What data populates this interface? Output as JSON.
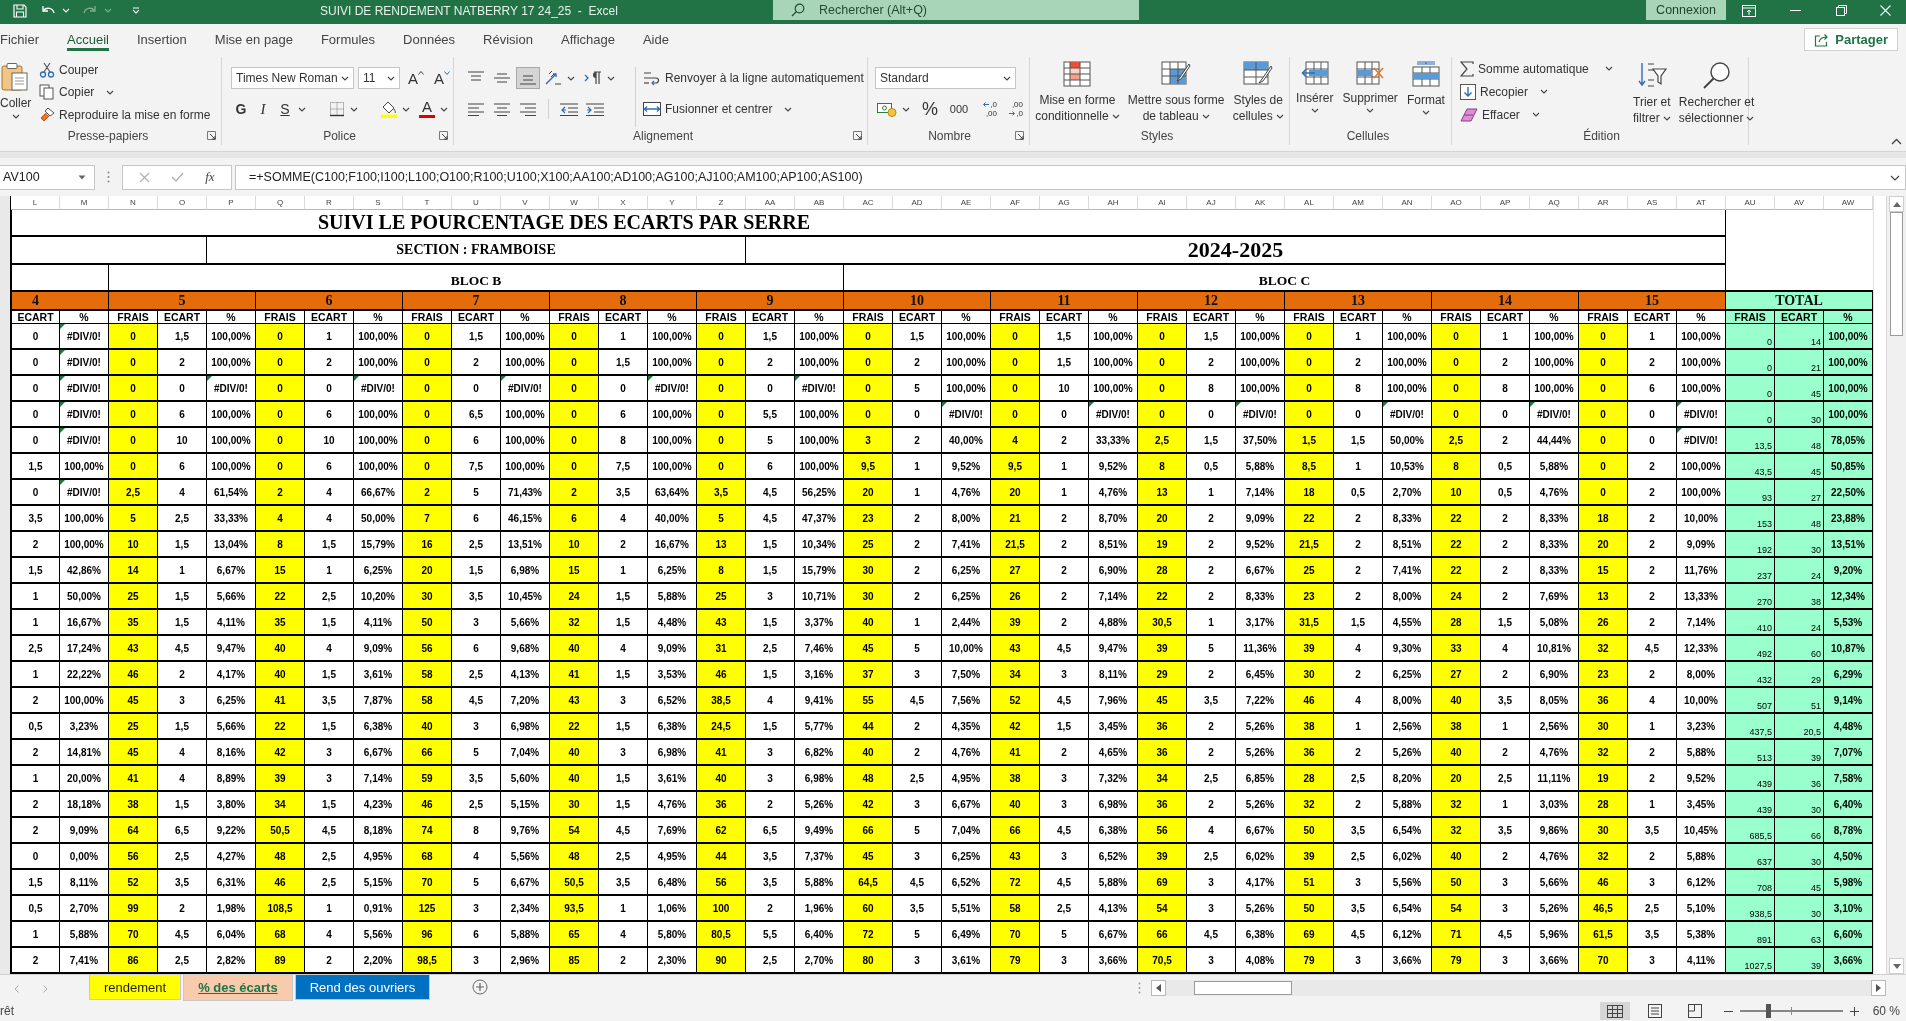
{
  "title_bar": {
    "title": "SUIVI DE RENDEMENT NATBERRY 17 24_25  -  Excel",
    "search_placeholder": "Rechercher (Alt+Q)",
    "account_button": "Connexion"
  },
  "menu_tabs": [
    {
      "label": "Fichier",
      "selected": false
    },
    {
      "label": "Accueil",
      "selected": true
    },
    {
      "label": "Insertion",
      "selected": false
    },
    {
      "label": "Mise en page",
      "selected": false
    },
    {
      "label": "Formules",
      "selected": false
    },
    {
      "label": "Données",
      "selected": false
    },
    {
      "label": "Révision",
      "selected": false
    },
    {
      "label": "Affichage",
      "selected": false
    },
    {
      "label": "Aide",
      "selected": false
    }
  ],
  "share_button": "Partager",
  "ribbon": {
    "clipboard": {
      "label": "Presse-papiers",
      "paste": "Coller",
      "cut": "Couper",
      "copy": "Copier",
      "format_painter": "Reproduire la mise en forme"
    },
    "font": {
      "label": "Police",
      "family": "Times New Roman",
      "size": "11",
      "grow": "A",
      "shrink": "A",
      "bold": "G",
      "italic": "I",
      "underline": "S",
      "font_color": "A"
    },
    "alignment": {
      "label": "Alignement",
      "vertical": [
        {
          "kind": "top",
          "selected": false
        },
        {
          "kind": "middle",
          "selected": false
        },
        {
          "kind": "bottom",
          "selected": true
        }
      ],
      "wrap_text": "Renvoyer à la ligne automatiquement",
      "merge": "Fusionner et centrer"
    },
    "number": {
      "label": "Nombre",
      "format": "Standard",
      "percent": "%",
      "thousands": "000",
      "decimals": [
        {
          "kind": "increase",
          "top": ",0",
          "bottom": ",00"
        },
        {
          "kind": "decrease",
          "top": ",00",
          "bottom": ",0"
        }
      ]
    },
    "styles": {
      "label": "Styles",
      "buttons": [
        {
          "kind": "conditional",
          "label": "Mise en forme\nconditionnelle"
        },
        {
          "kind": "table",
          "label": "Mettre sous forme\nde tableau"
        },
        {
          "kind": "cellstyles",
          "label": "Styles de\ncellules"
        }
      ]
    },
    "cells": {
      "label": "Cellules",
      "buttons": [
        {
          "kind": "insert",
          "label": "Insérer"
        },
        {
          "kind": "delete",
          "label": "Supprimer"
        },
        {
          "kind": "format",
          "label": "Format"
        }
      ]
    },
    "editing": {
      "label": "Édition",
      "autosum": "Somme automatique",
      "fill": "Recopier",
      "clear": "Effacer",
      "sort_filter": "Trier et\nfiltrer",
      "find_select": "Rechercher et\nsélectionner"
    }
  },
  "formula_bar": {
    "name_box": "AV100",
    "function_glyph": "fx",
    "formula": "=+SOMME(C100;F100;I100;L100;O100;R100;U100;X100;AA100;AD100;AG100;AJ100;AM100;AP100;AS100)"
  },
  "sheet": {
    "title": "SUIVI LE POURCENTAGE DES ECARTS PAR SERRE",
    "section": "SECTION : FRAMBOISE",
    "season": "2024-2025",
    "sections": [
      {
        "kind": "lead",
        "blocks": [
          {
            "label": "4",
            "kind": "serre",
            "columns": [
              {
                "letter": "L",
                "label": "ECART",
                "kind": "ecart"
              },
              {
                "letter": "M",
                "label": "%",
                "kind": "percent"
              }
            ]
          }
        ]
      },
      {
        "kind": "bloc",
        "label": "BLOC B",
        "blocks": [
          {
            "label": "5",
            "kind": "serre",
            "columns": [
              {
                "letter": "N",
                "label": "FRAIS",
                "kind": "frais"
              },
              {
                "letter": "O",
                "label": "ECART",
                "kind": "ecart"
              },
              {
                "letter": "P",
                "label": "%",
                "kind": "percent"
              }
            ]
          },
          {
            "label": "6",
            "kind": "serre",
            "columns": [
              {
                "letter": "Q",
                "label": "FRAIS",
                "kind": "frais"
              },
              {
                "letter": "R",
                "label": "ECART",
                "kind": "ecart"
              },
              {
                "letter": "S",
                "label": "%",
                "kind": "percent"
              }
            ]
          },
          {
            "label": "7",
            "kind": "serre",
            "columns": [
              {
                "letter": "T",
                "label": "FRAIS",
                "kind": "frais"
              },
              {
                "letter": "U",
                "label": "ECART",
                "kind": "ecart"
              },
              {
                "letter": "V",
                "label": "%",
                "kind": "percent"
              }
            ]
          },
          {
            "label": "8",
            "kind": "serre",
            "columns": [
              {
                "letter": "W",
                "label": "FRAIS",
                "kind": "frais"
              },
              {
                "letter": "X",
                "label": "ECART",
                "kind": "ecart"
              },
              {
                "letter": "Y",
                "label": "%",
                "kind": "percent"
              }
            ]
          },
          {
            "label": "9",
            "kind": "serre",
            "columns": [
              {
                "letter": "Z",
                "label": "FRAIS",
                "kind": "frais"
              },
              {
                "letter": "AA",
                "label": "ECART",
                "kind": "ecart"
              },
              {
                "letter": "AB",
                "label": "%",
                "kind": "percent"
              }
            ]
          }
        ]
      },
      {
        "kind": "bloc",
        "label": "BLOC C",
        "blocks": [
          {
            "label": "10",
            "kind": "serre",
            "columns": [
              {
                "letter": "AC",
                "label": "FRAIS",
                "kind": "frais"
              },
              {
                "letter": "AD",
                "label": "ECART",
                "kind": "ecart"
              },
              {
                "letter": "AE",
                "label": "%",
                "kind": "percent"
              }
            ]
          },
          {
            "label": "11",
            "kind": "serre",
            "columns": [
              {
                "letter": "AF",
                "label": "FRAIS",
                "kind": "frais"
              },
              {
                "letter": "AG",
                "label": "ECART",
                "kind": "ecart"
              },
              {
                "letter": "AH",
                "label": "%",
                "kind": "percent"
              }
            ]
          },
          {
            "label": "12",
            "kind": "serre",
            "columns": [
              {
                "letter": "AI",
                "label": "FRAIS",
                "kind": "frais"
              },
              {
                "letter": "AJ",
                "label": "ECART",
                "kind": "ecart"
              },
              {
                "letter": "AK",
                "label": "%",
                "kind": "percent"
              }
            ]
          },
          {
            "label": "13",
            "kind": "serre",
            "columns": [
              {
                "letter": "AL",
                "label": "FRAIS",
                "kind": "frais"
              },
              {
                "letter": "AM",
                "label": "ECART",
                "kind": "ecart"
              },
              {
                "letter": "AN",
                "label": "%",
                "kind": "percent"
              }
            ]
          },
          {
            "label": "14",
            "kind": "serre",
            "columns": [
              {
                "letter": "AO",
                "label": "FRAIS",
                "kind": "frais"
              },
              {
                "letter": "AP",
                "label": "ECART",
                "kind": "ecart"
              },
              {
                "letter": "AQ",
                "label": "%",
                "kind": "percent"
              }
            ]
          },
          {
            "label": "15",
            "kind": "serre",
            "columns": [
              {
                "letter": "AR",
                "label": "FRAIS",
                "kind": "frais"
              },
              {
                "letter": "AS",
                "label": "ECART",
                "kind": "ecart"
              },
              {
                "letter": "AT",
                "label": "%",
                "kind": "percent"
              }
            ]
          }
        ]
      },
      {
        "kind": "total",
        "blocks": [
          {
            "label": "TOTAL",
            "kind": "total",
            "columns": [
              {
                "letter": "AU",
                "label": "FRAIS",
                "kind": "totalvalue"
              },
              {
                "letter": "AV",
                "label": "ECART",
                "kind": "totalvalue"
              },
              {
                "letter": "AW",
                "label": "%",
                "kind": "totalpercent"
              }
            ]
          }
        ]
      }
    ],
    "rows": [
      [
        "0",
        {
          "text": "#DIV/0!",
          "flagged": true
        },
        "0",
        "1,5",
        "100,00%",
        "0",
        "1",
        "100,00%",
        "0",
        "1,5",
        "100,00%",
        "0",
        "1",
        "100,00%",
        "0",
        "1,5",
        "100,00%",
        "0",
        "1,5",
        "100,00%",
        "0",
        "1,5",
        "100,00%",
        "0",
        "1,5",
        "100,00%",
        "0",
        "1",
        "100,00%",
        "0",
        "1",
        "100,00%",
        "0",
        "1",
        "100,00%",
        "0",
        "14",
        "100,00%"
      ],
      [
        "0",
        {
          "text": "#DIV/0!",
          "flagged": true
        },
        "0",
        "2",
        "100,00%",
        "0",
        "2",
        "100,00%",
        "0",
        "2",
        "100,00%",
        "0",
        "1,5",
        "100,00%",
        "0",
        "2",
        "100,00%",
        "0",
        "2",
        "100,00%",
        "0",
        "1,5",
        "100,00%",
        "0",
        "2",
        "100,00%",
        "0",
        "2",
        "100,00%",
        "0",
        "2",
        "100,00%",
        "0",
        "2",
        "100,00%",
        "0",
        "21",
        "100,00%"
      ],
      [
        "0",
        {
          "text": "#DIV/0!",
          "flagged": true
        },
        "0",
        "0",
        {
          "text": "#DIV/0!",
          "flagged": true
        },
        "0",
        "0",
        {
          "text": "#DIV/0!",
          "flagged": true
        },
        "0",
        "0",
        {
          "text": "#DIV/0!",
          "flagged": true
        },
        "0",
        "0",
        {
          "text": "#DIV/0!",
          "flagged": true
        },
        "0",
        "0",
        {
          "text": "#DIV/0!",
          "flagged": true
        },
        "0",
        "5",
        "100,00%",
        "0",
        "10",
        "100,00%",
        "0",
        "8",
        "100,00%",
        "0",
        "8",
        "100,00%",
        "0",
        "8",
        "100,00%",
        "0",
        "6",
        "100,00%",
        "0",
        "45",
        "100,00%"
      ],
      [
        "0",
        {
          "text": "#DIV/0!",
          "flagged": true
        },
        "0",
        "6",
        "100,00%",
        "0",
        "6",
        "100,00%",
        "0",
        "6,5",
        "100,00%",
        "0",
        "6",
        "100,00%",
        "0",
        "5,5",
        "100,00%",
        "0",
        "0",
        {
          "text": "#DIV/0!",
          "flagged": true
        },
        "0",
        "0",
        {
          "text": "#DIV/0!",
          "flagged": true
        },
        "0",
        "0",
        {
          "text": "#DIV/0!",
          "flagged": true
        },
        "0",
        "0",
        {
          "text": "#DIV/0!",
          "flagged": true
        },
        "0",
        "0",
        {
          "text": "#DIV/0!",
          "flagged": true
        },
        "0",
        "0",
        {
          "text": "#DIV/0!",
          "flagged": true
        },
        "0",
        "30",
        "100,00%"
      ],
      [
        "0",
        {
          "text": "#DIV/0!",
          "flagged": true
        },
        "0",
        "10",
        "100,00%",
        "0",
        "10",
        "100,00%",
        "0",
        "6",
        "100,00%",
        "0",
        "8",
        "100,00%",
        "0",
        "5",
        "100,00%",
        "3",
        "2",
        "40,00%",
        "4",
        "2",
        "33,33%",
        "2,5",
        "1,5",
        "37,50%",
        "1,5",
        "1,5",
        "50,00%",
        "2,5",
        "2",
        "44,44%",
        "0",
        "0",
        {
          "text": "#DIV/0!",
          "flagged": true
        },
        "13,5",
        "48",
        "78,05%"
      ],
      [
        "1,5",
        "100,00%",
        "0",
        "6",
        "100,00%",
        "0",
        "6",
        "100,00%",
        "0",
        "7,5",
        "100,00%",
        "0",
        "7,5",
        "100,00%",
        "0",
        "6",
        "100,00%",
        "9,5",
        "1",
        "9,52%",
        "9,5",
        "1",
        "9,52%",
        "8",
        "0,5",
        "5,88%",
        "8,5",
        "1",
        "10,53%",
        "8",
        "0,5",
        "5,88%",
        "0",
        "2",
        "100,00%",
        "43,5",
        "45",
        "50,85%"
      ],
      [
        "0",
        {
          "text": "#DIV/0!",
          "flagged": true
        },
        "2,5",
        "4",
        "61,54%",
        "2",
        "4",
        "66,67%",
        "2",
        "5",
        "71,43%",
        "2",
        "3,5",
        "63,64%",
        "3,5",
        "4,5",
        "56,25%",
        "20",
        "1",
        "4,76%",
        "20",
        "1",
        "4,76%",
        "13",
        "1",
        "7,14%",
        "18",
        "0,5",
        "2,70%",
        "10",
        "0,5",
        "4,76%",
        "0",
        "2",
        "100,00%",
        "93",
        "27",
        "22,50%"
      ],
      [
        "3,5",
        "100,00%",
        "5",
        "2,5",
        "33,33%",
        "4",
        "4",
        "50,00%",
        "7",
        "6",
        "46,15%",
        "6",
        "4",
        "40,00%",
        "5",
        "4,5",
        "47,37%",
        "23",
        "2",
        "8,00%",
        "21",
        "2",
        "8,70%",
        "20",
        "2",
        "9,09%",
        "22",
        "2",
        "8,33%",
        "22",
        "2",
        "8,33%",
        "18",
        "2",
        "10,00%",
        "153",
        "48",
        "23,88%"
      ],
      [
        "2",
        "100,00%",
        "10",
        "1,5",
        "13,04%",
        "8",
        "1,5",
        "15,79%",
        "16",
        "2,5",
        "13,51%",
        "10",
        "2",
        "16,67%",
        "13",
        "1,5",
        "10,34%",
        "25",
        "2",
        "7,41%",
        "21,5",
        "2",
        "8,51%",
        "19",
        "2",
        "9,52%",
        "21,5",
        "2",
        "8,51%",
        "22",
        "2",
        "8,33%",
        "20",
        "2",
        "9,09%",
        "192",
        "30",
        "13,51%"
      ],
      [
        "1,5",
        "42,86%",
        "14",
        "1",
        "6,67%",
        "15",
        "1",
        "6,25%",
        "20",
        "1,5",
        "6,98%",
        "15",
        "1",
        "6,25%",
        "8",
        "1,5",
        "15,79%",
        "30",
        "2",
        "6,25%",
        "27",
        "2",
        "6,90%",
        "28",
        "2",
        "6,67%",
        "25",
        "2",
        "7,41%",
        "22",
        "2",
        "8,33%",
        "15",
        "2",
        "11,76%",
        "237",
        "24",
        "9,20%"
      ],
      [
        "1",
        "50,00%",
        "25",
        "1,5",
        "5,66%",
        "22",
        "2,5",
        "10,20%",
        "30",
        "3,5",
        "10,45%",
        "24",
        "1,5",
        "5,88%",
        "25",
        "3",
        "10,71%",
        "30",
        "2",
        "6,25%",
        "26",
        "2",
        "7,14%",
        "22",
        "2",
        "8,33%",
        "23",
        "2",
        "8,00%",
        "24",
        "2",
        "7,69%",
        "13",
        "2",
        "13,33%",
        "270",
        "38",
        "12,34%"
      ],
      [
        "1",
        "16,67%",
        "35",
        "1,5",
        "4,11%",
        "35",
        "1,5",
        "4,11%",
        "50",
        "3",
        "5,66%",
        "32",
        "1,5",
        "4,48%",
        "43",
        "1,5",
        "3,37%",
        "40",
        "1",
        "2,44%",
        "39",
        "2",
        "4,88%",
        "30,5",
        "1",
        "3,17%",
        "31,5",
        "1,5",
        "4,55%",
        "28",
        "1,5",
        "5,08%",
        "26",
        "2",
        "7,14%",
        "410",
        "24",
        "5,53%"
      ],
      [
        "2,5",
        "17,24%",
        "43",
        "4,5",
        "9,47%",
        "40",
        "4",
        "9,09%",
        "56",
        "6",
        "9,68%",
        "40",
        "4",
        "9,09%",
        "31",
        "2,5",
        "7,46%",
        "45",
        "5",
        "10,00%",
        "43",
        "4,5",
        "9,47%",
        "39",
        "5",
        "11,36%",
        "39",
        "4",
        "9,30%",
        "33",
        "4",
        "10,81%",
        "32",
        "4,5",
        "12,33%",
        "492",
        "60",
        "10,87%"
      ],
      [
        "1",
        "22,22%",
        "46",
        "2",
        "4,17%",
        "40",
        "1,5",
        "3,61%",
        "58",
        "2,5",
        "4,13%",
        "41",
        "1,5",
        "3,53%",
        "46",
        "1,5",
        "3,16%",
        "37",
        "3",
        "7,50%",
        "34",
        "3",
        "8,11%",
        "29",
        "2",
        "6,45%",
        "30",
        "2",
        "6,25%",
        "27",
        "2",
        "6,90%",
        "23",
        "2",
        "8,00%",
        "432",
        "29",
        "6,29%"
      ],
      [
        "2",
        "100,00%",
        "45",
        "3",
        "6,25%",
        "41",
        "3,5",
        "7,87%",
        "58",
        "4,5",
        "7,20%",
        "43",
        "3",
        "6,52%",
        "38,5",
        "4",
        "9,41%",
        "55",
        "4,5",
        "7,56%",
        "52",
        "4,5",
        "7,96%",
        "45",
        "3,5",
        "7,22%",
        "46",
        "4",
        "8,00%",
        "40",
        "3,5",
        "8,05%",
        "36",
        "4",
        "10,00%",
        "507",
        "51",
        "9,14%"
      ],
      [
        "0,5",
        "3,23%",
        "25",
        "1,5",
        "5,66%",
        "22",
        "1,5",
        "6,38%",
        "40",
        "3",
        "6,98%",
        "22",
        "1,5",
        "6,38%",
        "24,5",
        "1,5",
        "5,77%",
        "44",
        "2",
        "4,35%",
        "42",
        "1,5",
        "3,45%",
        "36",
        "2",
        "5,26%",
        "38",
        "1",
        "2,56%",
        "38",
        "1",
        "2,56%",
        "30",
        "1",
        "3,23%",
        "437,5",
        "20,5",
        "4,48%"
      ],
      [
        "2",
        "14,81%",
        "45",
        "4",
        "8,16%",
        "42",
        "3",
        "6,67%",
        "66",
        "5",
        "7,04%",
        "40",
        "3",
        "6,98%",
        "41",
        "3",
        "6,82%",
        "40",
        "2",
        "4,76%",
        "41",
        "2",
        "4,65%",
        "36",
        "2",
        "5,26%",
        "36",
        "2",
        "5,26%",
        "40",
        "2",
        "4,76%",
        "32",
        "2",
        "5,88%",
        "513",
        "39",
        "7,07%"
      ],
      [
        "1",
        "20,00%",
        "41",
        "4",
        "8,89%",
        "39",
        "3",
        "7,14%",
        "59",
        "3,5",
        "5,60%",
        "40",
        "1,5",
        "3,61%",
        "40",
        "3",
        "6,98%",
        "48",
        "2,5",
        "4,95%",
        "38",
        "3",
        "7,32%",
        "34",
        "2,5",
        "6,85%",
        "28",
        "2,5",
        "8,20%",
        "20",
        "2,5",
        "11,11%",
        "19",
        "2",
        "9,52%",
        "439",
        "36",
        "7,58%"
      ],
      [
        "2",
        "18,18%",
        "38",
        "1,5",
        "3,80%",
        "34",
        "1,5",
        "4,23%",
        "46",
        "2,5",
        "5,15%",
        "30",
        "1,5",
        "4,76%",
        "36",
        "2",
        "5,26%",
        "42",
        "3",
        "6,67%",
        "40",
        "3",
        "6,98%",
        "36",
        "2",
        "5,26%",
        "32",
        "2",
        "5,88%",
        "32",
        "1",
        "3,03%",
        "28",
        "1",
        "3,45%",
        "439",
        "30",
        "6,40%"
      ],
      [
        "2",
        "9,09%",
        "64",
        "6,5",
        "9,22%",
        "50,5",
        "4,5",
        "8,18%",
        "74",
        "8",
        "9,76%",
        "54",
        "4,5",
        "7,69%",
        "62",
        "6,5",
        "9,49%",
        "66",
        "5",
        "7,04%",
        "66",
        "4,5",
        "6,38%",
        "56",
        "4",
        "6,67%",
        "50",
        "3,5",
        "6,54%",
        "32",
        "3,5",
        "9,86%",
        "30",
        "3,5",
        "10,45%",
        "685,5",
        "66",
        "8,78%"
      ],
      [
        "0",
        "0,00%",
        "56",
        "2,5",
        "4,27%",
        "48",
        "2,5",
        "4,95%",
        "68",
        "4",
        "5,56%",
        "48",
        "2,5",
        "4,95%",
        "44",
        "3,5",
        "7,37%",
        "45",
        "3",
        "6,25%",
        "43",
        "3",
        "6,52%",
        "39",
        "2,5",
        "6,02%",
        "39",
        "2,5",
        "6,02%",
        "40",
        "2",
        "4,76%",
        "32",
        "2",
        "5,88%",
        "637",
        "30",
        "4,50%"
      ],
      [
        "1,5",
        "8,11%",
        "52",
        "3,5",
        "6,31%",
        "46",
        "2,5",
        "5,15%",
        "70",
        "5",
        "6,67%",
        "50,5",
        "3,5",
        "6,48%",
        "56",
        "3,5",
        "5,88%",
        "64,5",
        "4,5",
        "6,52%",
        "72",
        "4,5",
        "5,88%",
        "69",
        "3",
        "4,17%",
        "51",
        "3",
        "5,56%",
        "50",
        "3",
        "5,66%",
        "46",
        "3",
        "6,12%",
        "708",
        "45",
        "5,98%"
      ],
      [
        "0,5",
        "2,70%",
        "99",
        "2",
        "1,98%",
        "108,5",
        "1",
        "0,91%",
        "125",
        "3",
        "2,34%",
        "93,5",
        "1",
        "1,06%",
        "100",
        "2",
        "1,96%",
        "60",
        "3,5",
        "5,51%",
        "58",
        "2,5",
        "4,13%",
        "54",
        "3",
        "5,26%",
        "50",
        "3,5",
        "6,54%",
        "54",
        "3",
        "5,26%",
        "46,5",
        "2,5",
        "5,10%",
        "938,5",
        "30",
        "3,10%"
      ],
      [
        "1",
        "5,88%",
        "70",
        "4,5",
        "6,04%",
        "68",
        "4",
        "5,56%",
        "96",
        "6",
        "5,88%",
        "65",
        "4",
        "5,80%",
        "80,5",
        "5,5",
        "6,40%",
        "72",
        "5",
        "6,49%",
        "70",
        "5",
        "6,67%",
        "66",
        "4,5",
        "6,38%",
        "69",
        "4,5",
        "6,12%",
        "71",
        "4,5",
        "5,96%",
        "61,5",
        "3,5",
        "5,38%",
        "891",
        "63",
        "6,60%"
      ],
      [
        "2",
        "7,41%",
        "86",
        "2,5",
        "2,82%",
        "89",
        "2",
        "2,20%",
        "98,5",
        "3",
        "2,96%",
        "85",
        "2",
        "2,30%",
        "90",
        "2,5",
        "2,70%",
        "80",
        "3",
        "3,61%",
        "79",
        "3",
        "3,66%",
        "70,5",
        "3",
        "4,08%",
        "79",
        "3",
        "3,66%",
        "79",
        "3",
        "3,66%",
        "70",
        "3",
        "4,11%",
        "1027,5",
        "39",
        "3,66%"
      ]
    ]
  },
  "sheet_tabs": [
    {
      "label": "rendement",
      "selected": false,
      "color": "#ffff00"
    },
    {
      "label": "% des écarts",
      "selected": true,
      "color": "#f8cbad"
    },
    {
      "label": "Rend des ouvriers",
      "selected": false,
      "color": "#0070c0"
    }
  ],
  "status_bar": {
    "mode": "rêt",
    "views": [
      {
        "kind": "normal",
        "selected": true
      },
      {
        "kind": "layout",
        "selected": false
      },
      {
        "kind": "pagebreak",
        "selected": false
      }
    ],
    "zoom_slider": {
      "level": 0.28
    },
    "zoom": "60 %"
  }
}
